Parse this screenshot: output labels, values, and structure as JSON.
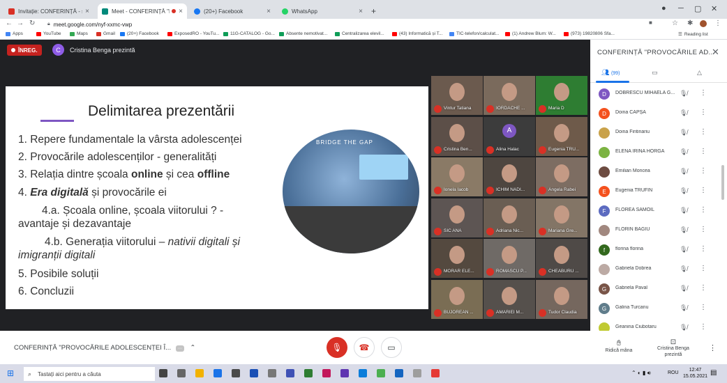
{
  "browser": {
    "tabs": [
      {
        "label": "Invitație: CONFERINȚĂ - sâm. 15 ...",
        "color": "#d93025"
      },
      {
        "label": "Meet - CONFERINȚĂ \"PROVO...",
        "color": "#00897b"
      },
      {
        "label": "(20+) Facebook",
        "color": "#1877f2"
      },
      {
        "label": "WhatsApp",
        "color": "#25d366"
      }
    ],
    "url": "meet.google.com/nyf-xxmc-vwp",
    "bookmarks": [
      {
        "label": "Apps",
        "color": "#4285f4"
      },
      {
        "label": "YouTube",
        "color": "#ff0000"
      },
      {
        "label": "Maps",
        "color": "#34a853"
      },
      {
        "label": "Gmail",
        "color": "#d93025"
      },
      {
        "label": "(20+) Facebook",
        "color": "#1877f2"
      },
      {
        "label": "ExposedRO - YouTu...",
        "color": "#ff0000"
      },
      {
        "label": "11G-CATALOG - Go...",
        "color": "#0f9d58"
      },
      {
        "label": "Absente nemotivat...",
        "color": "#0f9d58"
      },
      {
        "label": "Centralizarea elevil...",
        "color": "#0f9d58"
      },
      {
        "label": "(43) Informatică și T...",
        "color": "#ff0000"
      },
      {
        "label": "TIC-telefon/calculat...",
        "color": "#4285f4"
      },
      {
        "label": "(1) Andrew Blum: W...",
        "color": "#ff0000"
      },
      {
        "label": "(973) 19820806 Sfa...",
        "color": "#ff0000"
      }
    ],
    "reading_list": "Reading list"
  },
  "meet": {
    "rec_label": "ÎNREG.",
    "presenter_initial": "C",
    "presenter_text": "Cristina Benga prezintă",
    "slide": {
      "title": "Delimitarea prezentării",
      "items": [
        {
          "pre": "1. Repere fundamentale la vârsta adolescenței"
        },
        {
          "pre": "2. Provocările adolescenților - generalități"
        },
        {
          "pre": "3. Relația dintre școala ",
          "b1": "online",
          "mid": " și cea ",
          "b2": "offline"
        },
        {
          "pre": "4. ",
          "bi": "Era digitală",
          "post": " și provocările ei"
        },
        {
          "pre": "4.a. Școala online, școala viitorului ? -"
        },
        {
          "pre": "avantaje și dezavantaje"
        },
        {
          "pre": "4.b. Generația viitorului – ",
          "it": "nativii digitali și"
        },
        {
          "it": "imigranții digitali"
        },
        {
          "pre": "5. Posibile soluții"
        },
        {
          "pre": "6. Concluzii"
        }
      ],
      "image_text": "BRIDGE THE GAP"
    },
    "tiles": [
      {
        "name": "Vintur Tatiana",
        "bg": "#6b5a4e"
      },
      {
        "name": "IORDACHE ...",
        "bg": "#7a6a5c"
      },
      {
        "name": "Maria D",
        "bg": "#2e7d32"
      },
      {
        "name": "Cristina Ben...",
        "bg": "#5c4f48"
      },
      {
        "name": "Alina Halac",
        "bg": "#3c3c3c",
        "initial": "A"
      },
      {
        "name": "Eugenia TRU...",
        "bg": "#6e5a4a"
      },
      {
        "name": "Ionela Iacob",
        "bg": "#8a7a66"
      },
      {
        "name": "ICHIM NADI...",
        "bg": "#4e4640"
      },
      {
        "name": "Angela Rabei",
        "bg": "#7d6d62"
      },
      {
        "name": "SIC ANA",
        "bg": "#5d5553"
      },
      {
        "name": "Adriana Nic...",
        "bg": "#6a5e53"
      },
      {
        "name": "Mariana Gre...",
        "bg": "#837566"
      },
      {
        "name": "MORAR ELE...",
        "bg": "#54493f"
      },
      {
        "name": "ROMASCU P...",
        "bg": "#6f6a66"
      },
      {
        "name": "CHEABURU ...",
        "bg": "#4f4a47"
      },
      {
        "name": "BUJOREAN ...",
        "bg": "#7a6d54"
      },
      {
        "name": "AMARIEI M...",
        "bg": "#55504c"
      },
      {
        "name": "Tudor Claudia",
        "bg": "#75675e"
      }
    ]
  },
  "panel": {
    "title": "CONFERINȚĂ \"PROVOCĂRILE AD...",
    "people_count": "(99)",
    "participants": [
      {
        "name": "DOBRESCU MIHAELA G...",
        "initial": "D",
        "color": "#7e57c2"
      },
      {
        "name": "Doina CAPȘA",
        "initial": "D",
        "color": "#f4511e"
      },
      {
        "name": "Doina Fintinariu",
        "initial": "",
        "color": "#c9a24a"
      },
      {
        "name": "ELENA IRINA HORGA",
        "initial": "",
        "color": "#7cb342"
      },
      {
        "name": "Emilian Moncea",
        "initial": "",
        "color": "#6d4c41"
      },
      {
        "name": "Eugenia TRUFIN",
        "initial": "E",
        "color": "#f4511e"
      },
      {
        "name": "FLOREA SAMOIL",
        "initial": "F",
        "color": "#5c6bc0"
      },
      {
        "name": "FLORIN BAGIU",
        "initial": "",
        "color": "#a1887f"
      },
      {
        "name": "florina florina",
        "initial": "f",
        "color": "#33691e"
      },
      {
        "name": "Gabriela Dobrea",
        "initial": "",
        "color": "#bcaaa4"
      },
      {
        "name": "Gabriela Paval",
        "initial": "G",
        "color": "#795548"
      },
      {
        "name": "Galina Turcanu",
        "initial": "G",
        "color": "#607d8b"
      },
      {
        "name": "Geanina Ciubotaru",
        "initial": "",
        "color": "#c0ca33"
      }
    ]
  },
  "bottom": {
    "meeting_title": "CONFERINȚĂ \"PROVOCĂRILE ADOLESCENȚEI Î...",
    "raise_hand": "Ridică mâna",
    "presenter_btn": "Cristina Benga prezintă"
  },
  "taskbar": {
    "search_placeholder": "Tastați aici pentru a căuta",
    "lang": "ROU",
    "time": "12:47",
    "date": "15.05.2021"
  }
}
